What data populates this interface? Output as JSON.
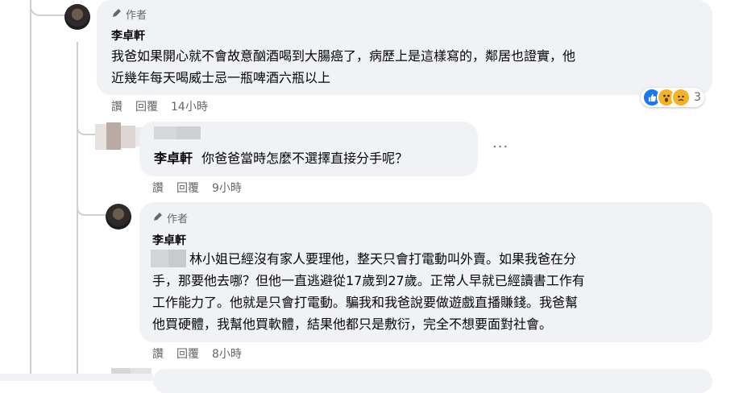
{
  "comments": [
    {
      "author_tag": "作者",
      "name": "李卓軒",
      "text_lines": [
        "我爸如果開心就不會故意酗酒喝到大腸癌了，病歷上是這樣寫的，鄰居也證實，他",
        "近幾年每天喝威士忌一瓶啤酒六瓶以上"
      ],
      "actions": {
        "like": "讚",
        "reply": "回覆",
        "time": "14小時"
      },
      "reactions": {
        "count": "3",
        "icons": [
          "like-reaction",
          "wow-reaction",
          "sad-reaction"
        ]
      }
    },
    {
      "mention": "李卓軒",
      "text": "你爸爸當時怎麼不選擇直接分手呢？",
      "actions": {
        "like": "讚",
        "reply": "回覆",
        "time": "9小時"
      },
      "more": "···"
    },
    {
      "author_tag": "作者",
      "name": "李卓軒",
      "text_lines": [
        "林小姐已經沒有家人要理他，整天只會打電動叫外賣。如果我爸在分",
        "手，那要他去哪？但他一直逃避從17歲到27歲。正常人早就已經讀書工作有",
        "工作能力了。他就是只會打電動。騙我和我爸說要做遊戲直播賺錢。我爸幫",
        "他買硬體，我幫他買軟體，結果他都只是敷衍，完全不想要面對社會。"
      ],
      "actions": {
        "like": "讚",
        "reply": "回覆",
        "time": "8小時"
      }
    }
  ],
  "colors": {
    "bubble": "#f0f2f5",
    "meta": "#65676b",
    "line": "#ced0d4",
    "like": "#1877f2"
  }
}
